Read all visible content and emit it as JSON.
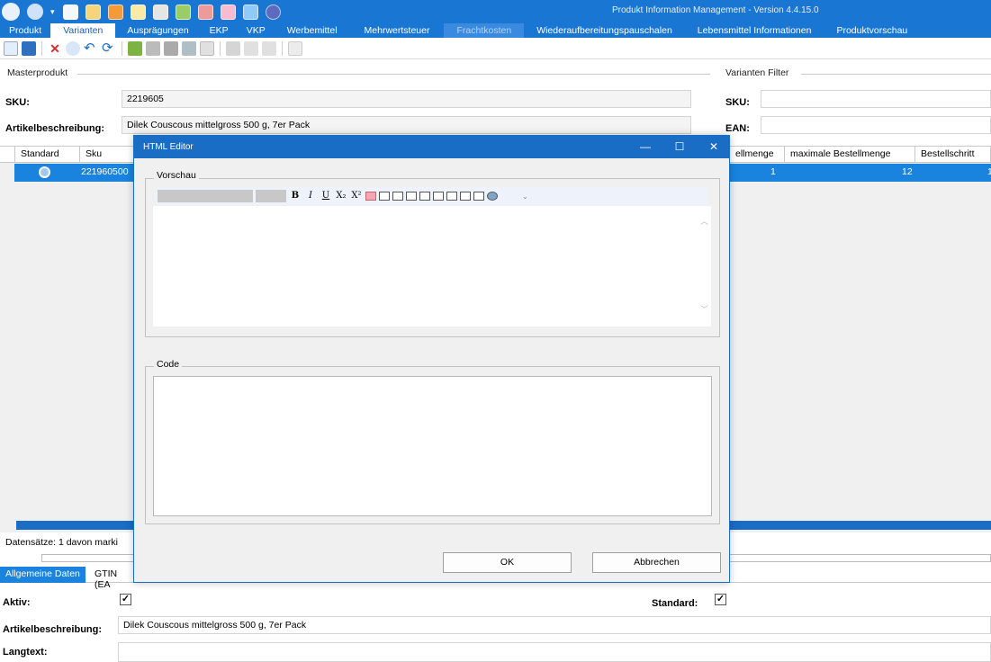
{
  "app_title": "Produkt Information Management - Version 4.4.15.0",
  "ribbon_tabs": [
    {
      "label": "Produkt",
      "state": "normal"
    },
    {
      "label": "Varianten",
      "state": "active"
    },
    {
      "label": "Ausprägungen",
      "state": "normal"
    },
    {
      "label": "EKP",
      "state": "normal"
    },
    {
      "label": "VKP",
      "state": "normal"
    },
    {
      "label": "Werbemittel",
      "state": "normal"
    },
    {
      "label": "Mehrwertsteuer",
      "state": "normal"
    },
    {
      "label": "Frachtkosten",
      "state": "dim"
    },
    {
      "label": "Wiederaufbereitungspauschalen",
      "state": "normal"
    },
    {
      "label": "Lebensmittel Informationen",
      "state": "normal"
    },
    {
      "label": "Produktvorschau",
      "state": "normal"
    }
  ],
  "masterprodukt": {
    "group_label": "Masterprodukt",
    "sku_label": "SKU:",
    "sku_value": "2219605",
    "desc_label": "Artikelbeschreibung:",
    "desc_value": "Dilek Couscous mittelgross 500 g, 7er Pack"
  },
  "varianten_filter": {
    "group_label": "Varianten Filter",
    "sku_label": "SKU:",
    "ean_label": "EAN:"
  },
  "grid": {
    "columns_left": [
      "Standard",
      "Sku"
    ],
    "columns_right": [
      "ellmenge",
      "maximale Bestellmenge",
      "Bestellschritt"
    ],
    "row": {
      "sku": "221960500",
      "min": "1",
      "max": "12",
      "step": "1"
    }
  },
  "status": "Datensätze: 1  davon marki",
  "bottom_tabs": [
    "Allgemeine Daten",
    "GTIN (EA"
  ],
  "detail": {
    "aktiv_label": "Aktiv:",
    "standard_label": "Standard:",
    "desc_label": "Artikelbeschreibung:",
    "desc_value": "Dilek Couscous mittelgross 500 g, 7er Pack",
    "langtext_label": "Langtext:",
    "check_mark": "✓"
  },
  "dialog": {
    "title": "HTML Editor",
    "preview_legend": "Vorschau",
    "code_legend": "Code",
    "ok_label": "OK",
    "cancel_label": "Abbrechen",
    "minimize": "—",
    "maximize": "☐",
    "close": "✕"
  },
  "editor_toolbar": {
    "bold": "B",
    "italic": "I",
    "underline": "U",
    "subscript": "X₂",
    "superscript": "X²"
  },
  "colors": {
    "accent": "#1976d2",
    "selection": "#1983de"
  }
}
